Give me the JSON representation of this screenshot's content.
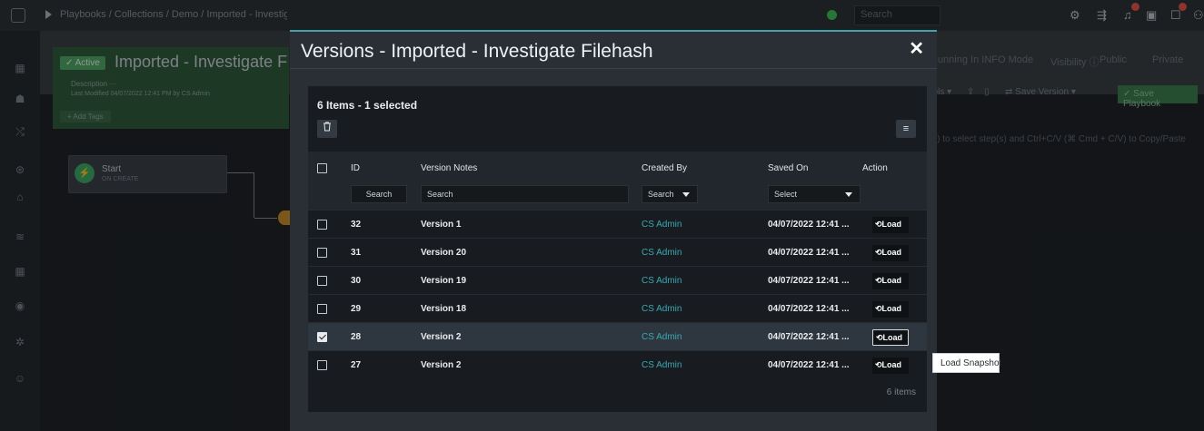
{
  "background": {
    "breadcrumb": "Playbooks / Collections / Demo / Imported - Investiga",
    "search_placeholder": "Search",
    "active_label": "✓ Active",
    "playbook_title": "Imported - Investigate Filehash",
    "description_label": "Description ···",
    "last_modified": "Last Modified 04/07/2022 12:41 PM by CS Admin",
    "add_tags": "+ Add Tags",
    "running_mode": "Running In INFO Mode",
    "visibility": "Visibility ⓘ",
    "public_label": "Public",
    "private_label": "Private",
    "tools_label": "ools ▾",
    "save_version": "⇄ Save Version ▾",
    "save_playbook": "✓ Save Playbook",
    "hint": "nd) to select step(s) and Ctrl+C/V (⌘ Cmd + C/V) to Copy/Paste",
    "start_step_title": "Start",
    "start_step_sub": "ON CREATE"
  },
  "modal": {
    "title": "Versions - Imported - Investigate Filehash",
    "close_glyph": "✕",
    "selection_summary": "6 Items - 1 selected",
    "columns": {
      "id": "ID",
      "notes": "Version Notes",
      "created_by": "Created By",
      "saved_on": "Saved On",
      "action": "Action"
    },
    "filters": {
      "id": "Search",
      "notes": "Search",
      "created_by": "Search",
      "saved_on": "Select"
    },
    "rows": [
      {
        "id": "32",
        "notes": "Version 1",
        "created_by": "CS Admin",
        "saved_on": "04/07/2022 12:41 ...",
        "action": "Load",
        "checked": false
      },
      {
        "id": "31",
        "notes": "Version 20",
        "created_by": "CS Admin",
        "saved_on": "04/07/2022 12:41 ...",
        "action": "Load",
        "checked": false
      },
      {
        "id": "30",
        "notes": "Version 19",
        "created_by": "CS Admin",
        "saved_on": "04/07/2022 12:41 ...",
        "action": "Load",
        "checked": false
      },
      {
        "id": "29",
        "notes": "Version 18",
        "created_by": "CS Admin",
        "saved_on": "04/07/2022 12:41 ...",
        "action": "Load",
        "checked": false
      },
      {
        "id": "28",
        "notes": "Version 2",
        "created_by": "CS Admin",
        "saved_on": "04/07/2022 12:41 ...",
        "action": "Load",
        "checked": true
      },
      {
        "id": "27",
        "notes": "Version 2",
        "created_by": "CS Admin",
        "saved_on": "04/07/2022 12:41 ...",
        "action": "Load",
        "checked": false
      }
    ],
    "footer": "6 items",
    "tooltip": "Load Snapshot"
  },
  "colors": {
    "accent": "#47a0a8",
    "creator_link": "#3aa9b2",
    "active_green": "#4fa866"
  },
  "icons": {
    "trash": "trash-icon",
    "column_menu": "menu-icon",
    "load": "undo-icon"
  }
}
